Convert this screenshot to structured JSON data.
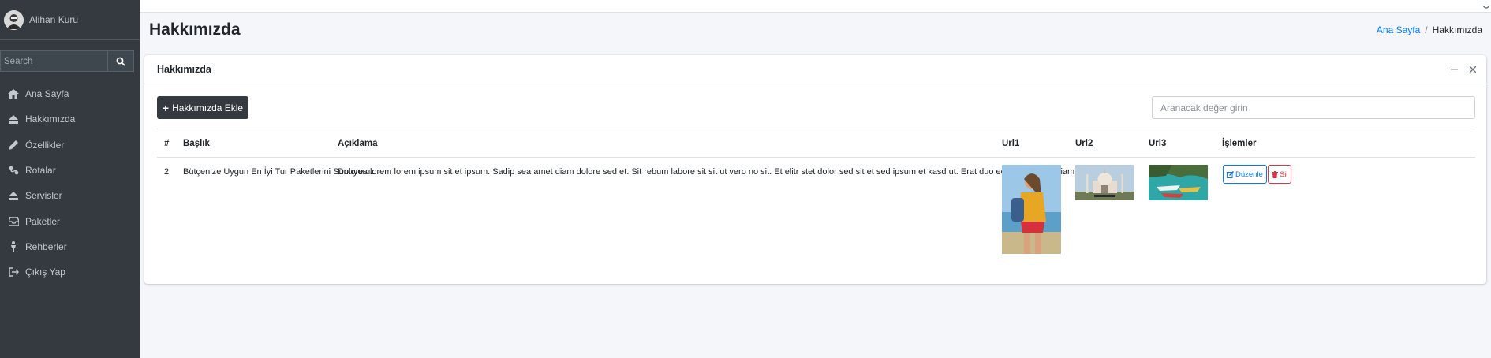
{
  "sidebar": {
    "user_name": "Alihan Kuru",
    "search_placeholder": "Search",
    "items": [
      {
        "label": "Ana Sayfa",
        "icon": "home-icon"
      },
      {
        "label": "Hakkımızda",
        "icon": "eject-icon"
      },
      {
        "label": "Özellikler",
        "icon": "pencil-icon"
      },
      {
        "label": "Rotalar",
        "icon": "route-icon"
      },
      {
        "label": "Servisler",
        "icon": "eject-icon"
      },
      {
        "label": "Paketler",
        "icon": "inbox-icon"
      },
      {
        "label": "Rehberler",
        "icon": "person-icon"
      },
      {
        "label": "Çıkış Yap",
        "icon": "sign-out-icon"
      }
    ]
  },
  "header": {
    "title": "Hakkımızda",
    "breadcrumb": {
      "home": "Ana Sayfa",
      "separator": "/",
      "current": "Hakkımızda"
    }
  },
  "card": {
    "title": "Hakkımızda",
    "add_button": "Hakkımızda Ekle",
    "search_placeholder": "Aranacak değer girin",
    "table": {
      "headers": {
        "num": "#",
        "title": "Başlık",
        "desc": "Açıklama",
        "url1": "Url1",
        "url2": "Url2",
        "url3": "Url3",
        "ops": "İşlemler"
      },
      "rows": [
        {
          "num": "2",
          "title": "Bütçenize Uygun En İyi Tur Paketlerini Sunuyoruz",
          "desc": "Dolores lorem lorem ipsum sit et ipsum. Sadip sea amet diam dolore sed et. Sit rebum labore sit sit ut vero no sit. Et elitr stet dolor sed sit et sed ipsum et kasd ut. Erat duo eos et erat sed diam duo",
          "edit": "Düzenle",
          "delete": "Sil"
        }
      ]
    }
  },
  "colors": {
    "sidebar": "#343a40",
    "link": "#007bff",
    "danger": "#dc3545"
  }
}
